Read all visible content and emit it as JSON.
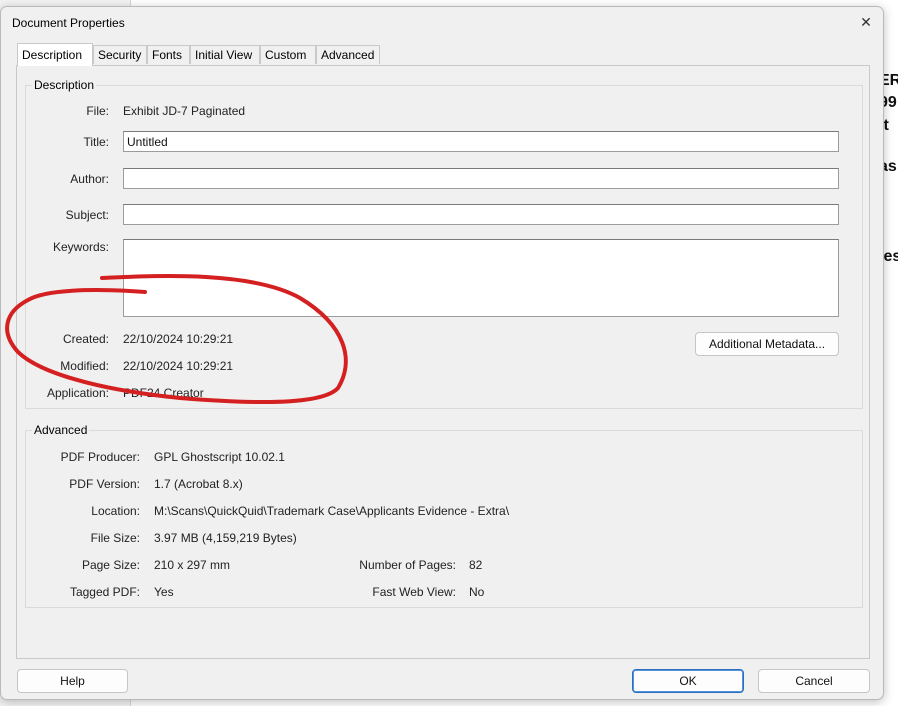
{
  "background_fragments": [
    "ER",
    "99",
    "it",
    "as",
    "ies"
  ],
  "dialog": {
    "title": "Document Properties",
    "close_glyph": "✕",
    "tabs": [
      {
        "label": "Description",
        "active": true
      },
      {
        "label": "Security"
      },
      {
        "label": "Fonts"
      },
      {
        "label": "Initial View"
      },
      {
        "label": "Custom"
      },
      {
        "label": "Advanced"
      }
    ]
  },
  "description": {
    "group_title": "Description",
    "file_label": "File:",
    "file_value": "Exhibit JD-7 Paginated",
    "title_label": "Title:",
    "title_value": "Untitled",
    "author_label": "Author:",
    "author_value": "",
    "subject_label": "Subject:",
    "subject_value": "",
    "keywords_label": "Keywords:",
    "keywords_value": "",
    "created_label": "Created:",
    "created_value": "22/10/2024 10:29:21",
    "modified_label": "Modified:",
    "modified_value": "22/10/2024 10:29:21",
    "application_label": "Application:",
    "application_value": "PDF24 Creator",
    "additional_metadata_label": "Additional Metadata..."
  },
  "advanced": {
    "group_title": "Advanced",
    "producer_label": "PDF Producer:",
    "producer_value": "GPL Ghostscript 10.02.1",
    "version_label": "PDF Version:",
    "version_value": "1.7 (Acrobat 8.x)",
    "location_label": "Location:",
    "location_value": "M:\\Scans\\QuickQuid\\Trademark Case\\Applicants Evidence - Extra\\",
    "filesize_label": "File Size:",
    "filesize_value": "3.97 MB (4,159,219 Bytes)",
    "pagesize_label": "Page Size:",
    "pagesize_value": "210 x 297 mm",
    "numpages_label": "Number of Pages:",
    "numpages_value": "82",
    "tagged_label": "Tagged PDF:",
    "tagged_value": "Yes",
    "fastweb_label": "Fast Web View:",
    "fastweb_value": "No"
  },
  "footer": {
    "help_label": "Help",
    "ok_label": "OK",
    "cancel_label": "Cancel"
  },
  "colors": {
    "annotation": "#d42020",
    "dialog_bg": "#f0f0f0",
    "ok_border": "#2b6fc2"
  }
}
